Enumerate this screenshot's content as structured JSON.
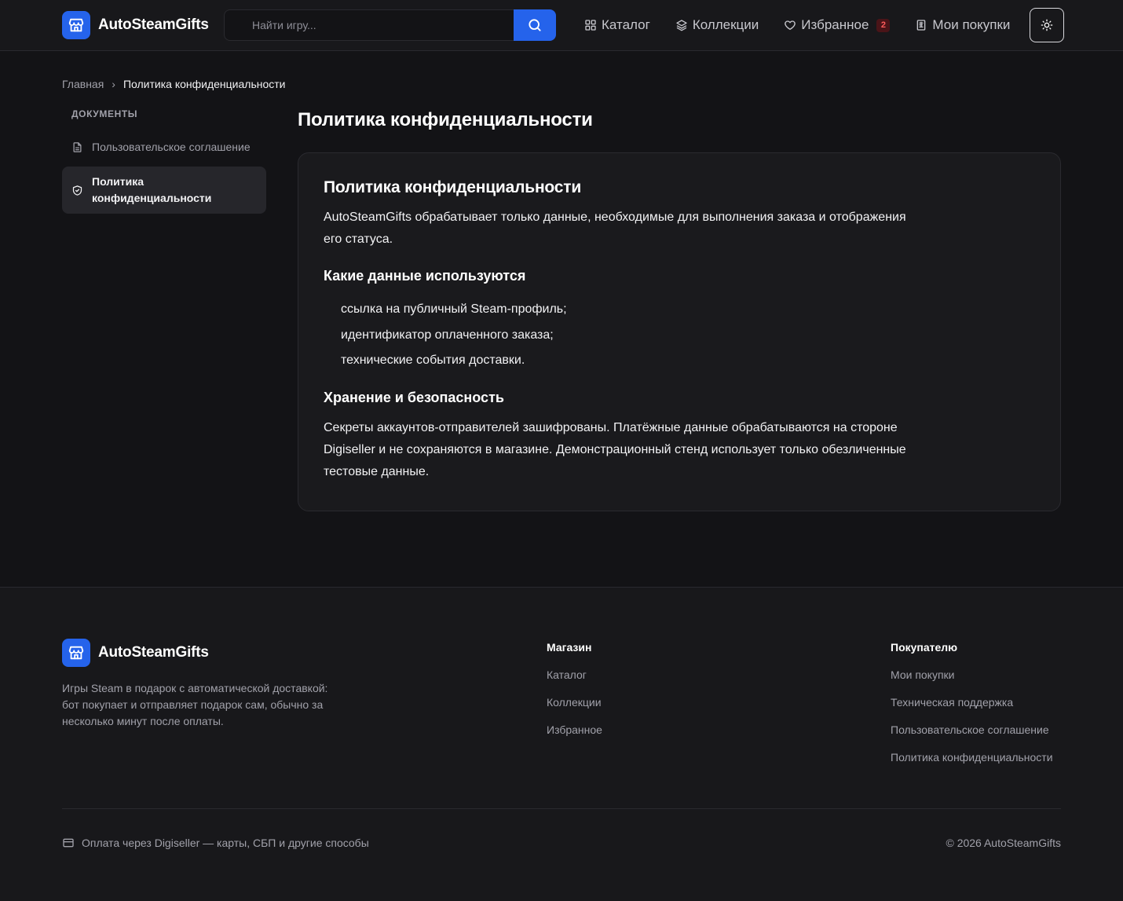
{
  "brand": {
    "name": "AutoSteamGifts",
    "accent": "#2563eb"
  },
  "header": {
    "search": {
      "placeholder": "Найти игру..."
    },
    "nav": [
      {
        "label": "Каталог",
        "icon": "grid-icon"
      },
      {
        "label": "Коллекции",
        "icon": "layers-icon"
      },
      {
        "label": "Избранное",
        "icon": "heart-icon",
        "badge": "2"
      },
      {
        "label": "Мои покупки",
        "icon": "receipt-icon"
      }
    ],
    "theme_toggle_icon": "sun-icon"
  },
  "breadcrumb": {
    "home": "Главная",
    "separator": "›",
    "current": "Политика конфиденциальности"
  },
  "sidebar": {
    "title": "ДОКУМЕНТЫ",
    "items": [
      {
        "label": "Пользовательское соглашение",
        "icon": "document-icon",
        "active": false
      },
      {
        "label": "Политика конфиденциальности",
        "icon": "shield-icon",
        "active": true
      }
    ]
  },
  "main": {
    "page_title": "Политика конфиденциальности",
    "card": {
      "heading": "Политика конфиденциальности",
      "intro": "AutoSteamGifts обрабатывает только данные, необходимые для выполнения заказа и отображения его статуса.",
      "section1_title": "Какие данные используются",
      "section1_items": [
        "ссылка на публичный Steam-профиль;",
        "идентификатор оплаченного заказа;",
        "технические события доставки."
      ],
      "section2_title": "Хранение и безопасность",
      "section2_text": "Секреты аккаунтов-отправителей зашифрованы. Платёжные данные обрабатываются на стороне Digiseller и не сохраняются в магазине. Демонстрационный стенд использует только обезличенные тестовые данные."
    }
  },
  "footer": {
    "brand": "AutoSteamGifts",
    "description": "Игры Steam в подарок с автоматической доставкой: бот покупает и отправляет подарок сам, обычно за несколько минут после оплаты.",
    "col1": {
      "title": "Магазин",
      "links": [
        "Каталог",
        "Коллекции",
        "Избранное"
      ]
    },
    "col2": {
      "title": "Покупателю",
      "links": [
        "Мои покупки",
        "Техническая поддержка",
        "Пользовательское соглашение",
        "Политика конфиденциальности"
      ]
    },
    "payment": "Оплата через Digiseller — карты, СБП и другие способы",
    "copyright": "© 2026 AutoSteamGifts"
  }
}
